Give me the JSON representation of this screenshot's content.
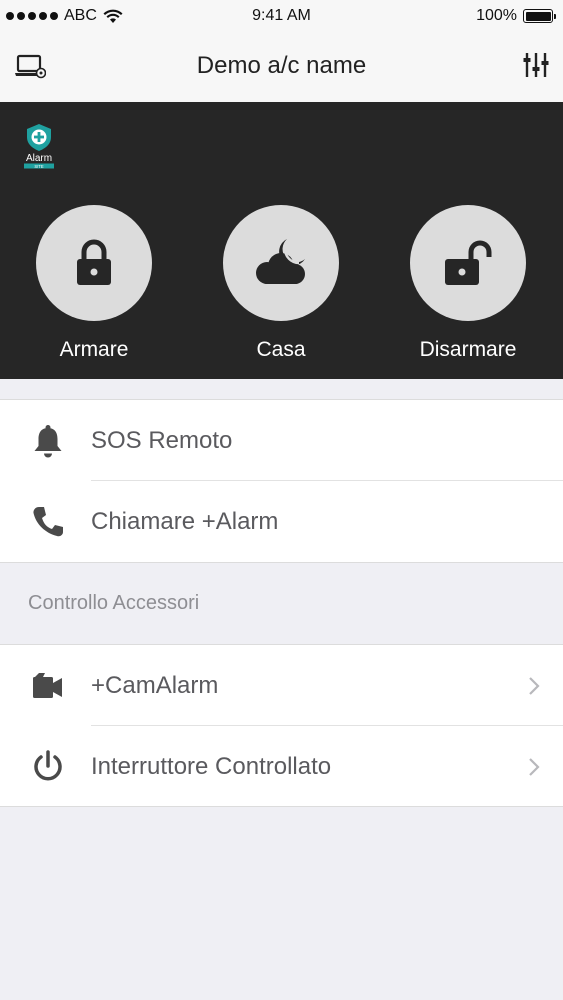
{
  "status_bar": {
    "carrier": "ABC",
    "time": "9:41 AM",
    "battery": "100%"
  },
  "nav": {
    "title": "Demo a/c name",
    "left_icon": "laptop-gear-icon",
    "right_icon": "sliders-icon"
  },
  "brand": {
    "name": "Alarm",
    "sub": "SITE"
  },
  "modes": [
    {
      "label": "Armare",
      "icon": "lock-icon"
    },
    {
      "label": "Casa",
      "icon": "moon-cloud-icon"
    },
    {
      "label": "Disarmare",
      "icon": "unlock-icon"
    }
  ],
  "actions": [
    {
      "label": "SOS Remoto",
      "icon": "bell-icon"
    },
    {
      "label": "Chiamare +Alarm",
      "icon": "phone-icon"
    }
  ],
  "accessories": {
    "header": "Controllo Accessori",
    "items": [
      {
        "label": "+CamAlarm",
        "icon": "video-camera-icon"
      },
      {
        "label": "Interruttore Controllato",
        "icon": "power-icon"
      }
    ]
  },
  "colors": {
    "panel": "#262626",
    "button": "#dcdcdc",
    "accent": "#1fa1a0"
  }
}
